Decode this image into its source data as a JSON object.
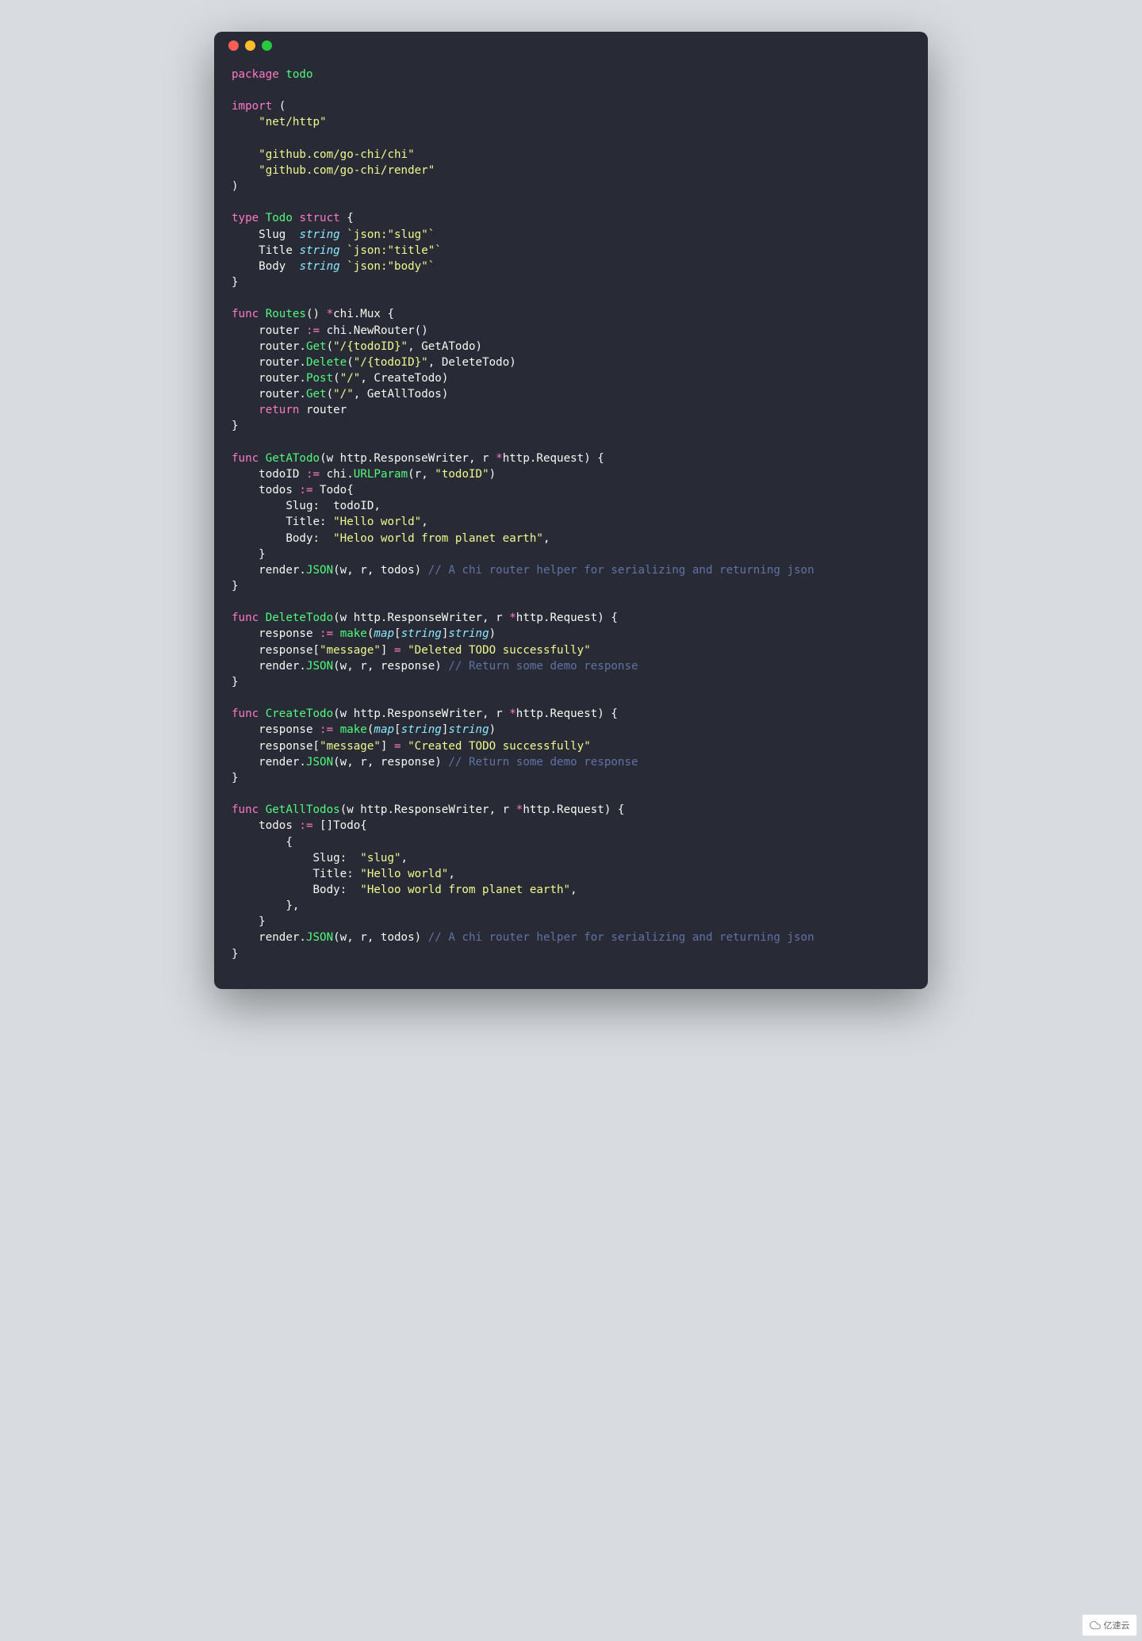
{
  "code": {
    "package_name": "todo",
    "imports": [
      "\"net/http\"",
      "\"github.com/go-chi/chi\"",
      "\"github.com/go-chi/render\""
    ],
    "struct": {
      "name": "Todo",
      "fields": [
        {
          "name": "Slug",
          "type": "string",
          "tag": "`json:\"slug\"`"
        },
        {
          "name": "Title",
          "type": "string",
          "tag": "`json:\"title\"`"
        },
        {
          "name": "Body",
          "type": "string",
          "tag": "`json:\"body\"`"
        }
      ]
    },
    "routes_fn": {
      "name": "Routes",
      "return": "*chi.Mux",
      "router_var": "router",
      "new_router_call": "chi.NewRouter()",
      "lines": [
        {
          "method": "Get",
          "path": "\"/{todoID}\"",
          "handler": "GetATodo"
        },
        {
          "method": "Delete",
          "path": "\"/{todoID}\"",
          "handler": "DeleteTodo"
        },
        {
          "method": "Post",
          "path": "\"/\"",
          "handler": "CreateTodo"
        },
        {
          "method": "Get",
          "path": "\"/\"",
          "handler": "GetAllTodos"
        }
      ],
      "return_stmt": "router"
    },
    "fn_getatodo": {
      "name": "GetATodo",
      "params": "(w http.ResponseWriter, r *http.Request)",
      "url_param_key": "\"todoID\"",
      "todo_slug_var": "todoID",
      "title_val": "\"Hello world\"",
      "body_val": "\"Heloo world from planet earth\"",
      "render_call": "render.JSON(w, r, todos)",
      "comment": "// A chi router helper for serializing and returning json"
    },
    "fn_deletetodo": {
      "name": "DeleteTodo",
      "params": "(w http.ResponseWriter, r *http.Request)",
      "make_call": "make(map[string]string)",
      "msg_key": "\"message\"",
      "msg_val": "\"Deleted TODO successfully\"",
      "render_call": "render.JSON(w, r, response)",
      "comment": "// Return some demo response"
    },
    "fn_createtodo": {
      "name": "CreateTodo",
      "params": "(w http.ResponseWriter, r *http.Request)",
      "make_call": "make(map[string]string)",
      "msg_key": "\"message\"",
      "msg_val": "\"Created TODO successfully\"",
      "render_call": "render.JSON(w, r, response)",
      "comment": "// Return some demo response"
    },
    "fn_getalltodos": {
      "name": "GetAllTodos",
      "params": "(w http.ResponseWriter, r *http.Request)",
      "slug_val": "\"slug\"",
      "title_val": "\"Hello world\"",
      "body_val": "\"Heloo world from planet earth\"",
      "render_call": "render.JSON(w, r, todos)",
      "comment": "// A chi router helper for serializing and returning json"
    }
  },
  "watermark": "亿速云"
}
